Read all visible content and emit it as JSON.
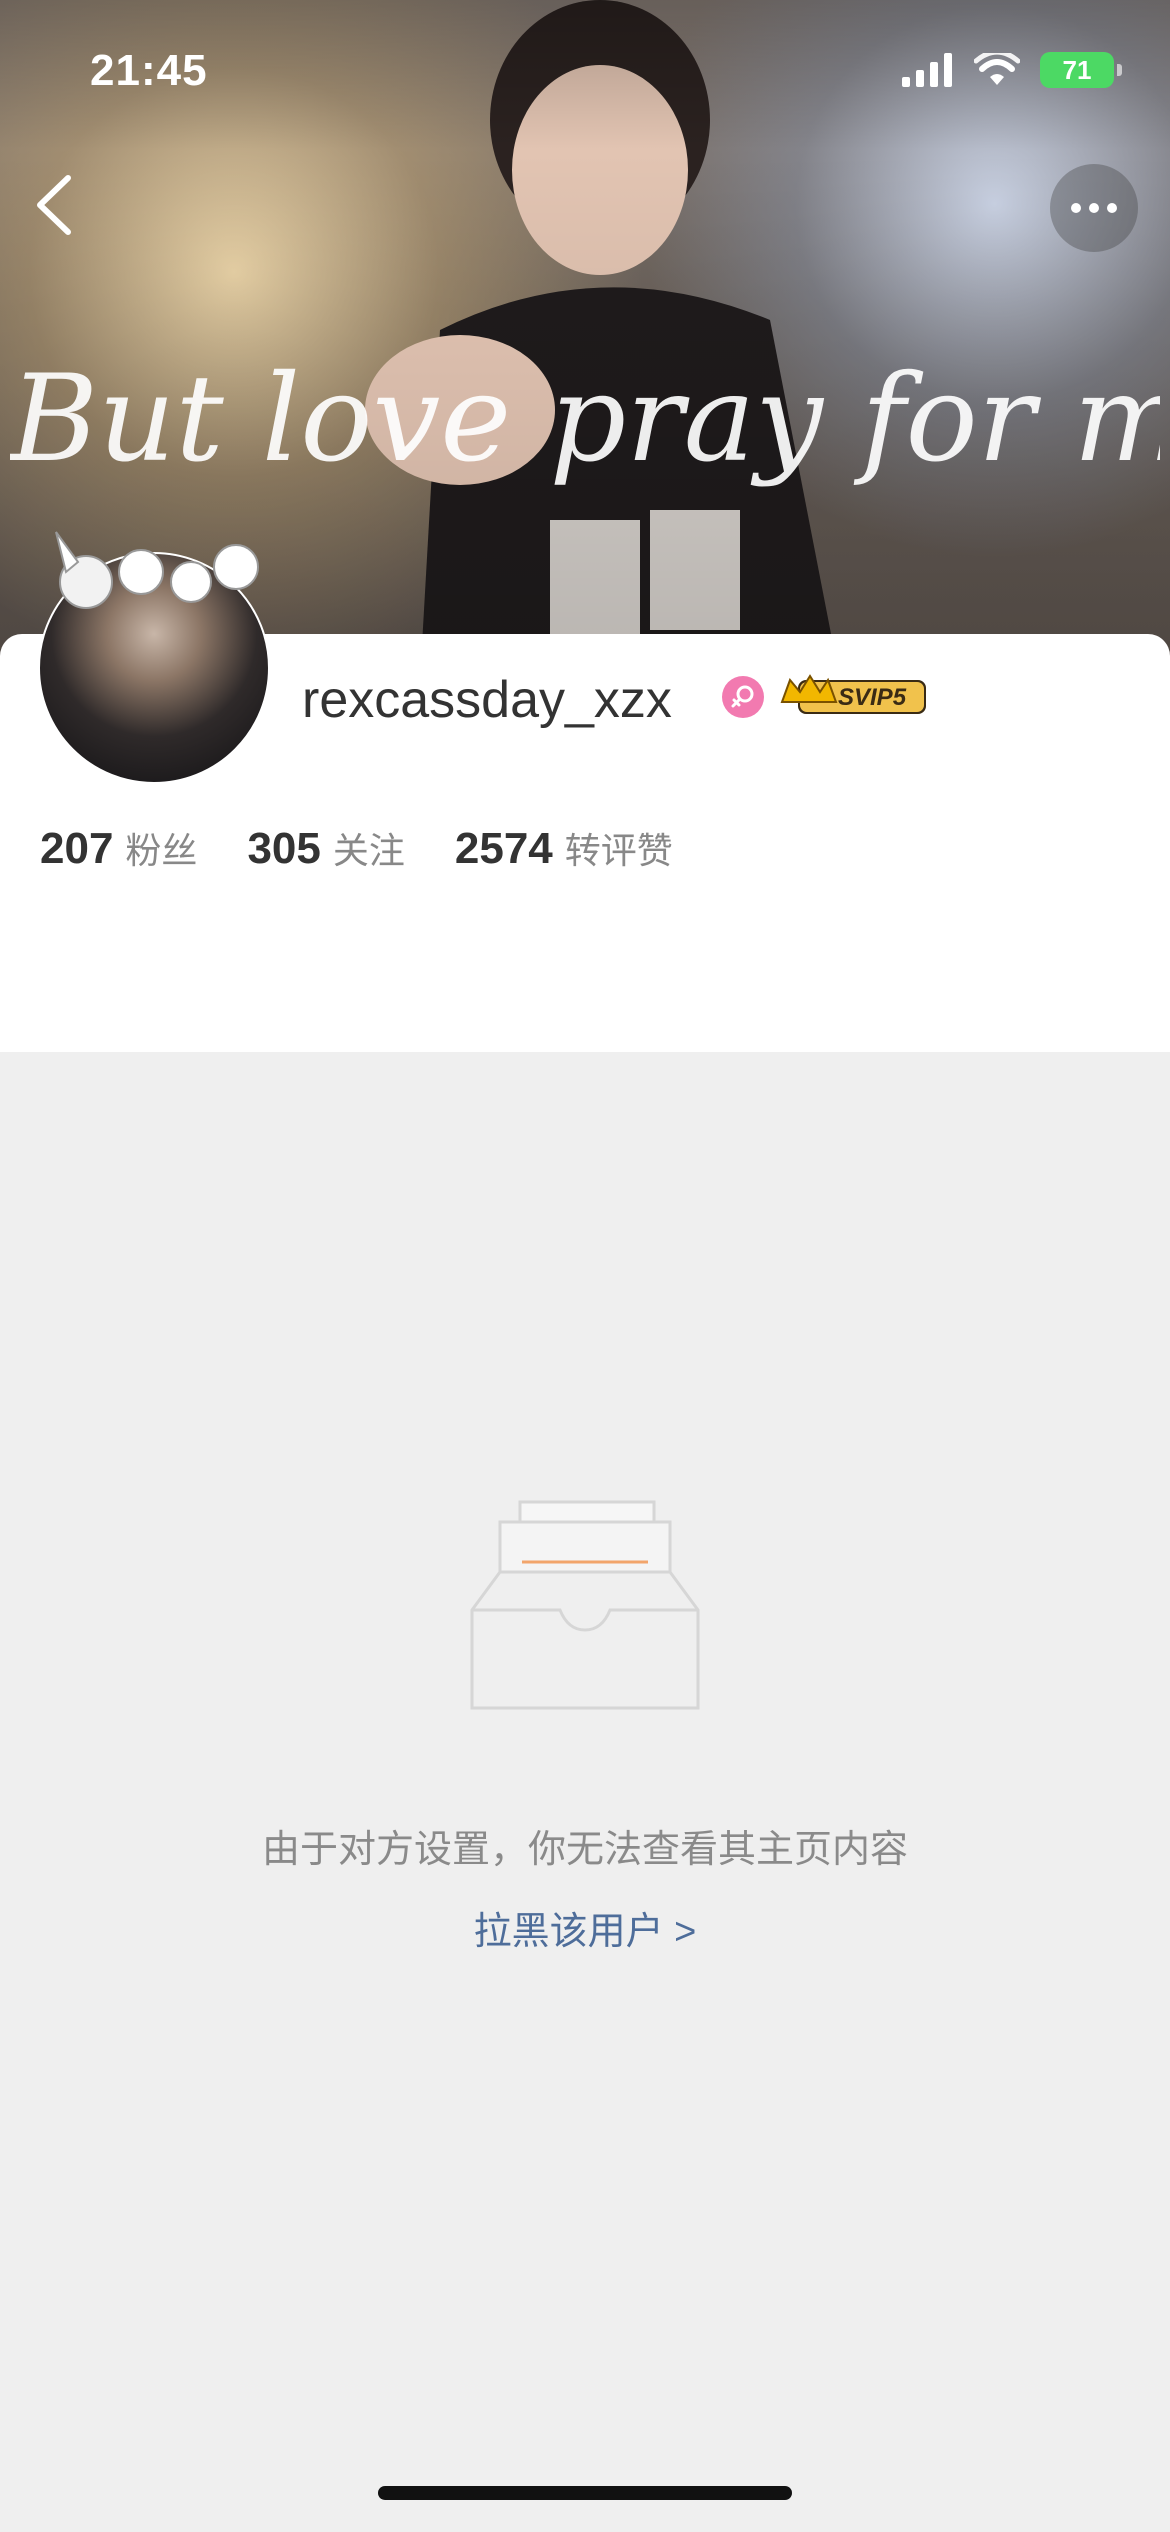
{
  "status_bar": {
    "time": "21:45",
    "battery": "71"
  },
  "header": {
    "back_icon": "chevron-left-icon",
    "more_icon": "ellipsis-icon",
    "cover_text": "But love pray for me"
  },
  "profile": {
    "username": "rexcassday_xzx",
    "gender_icon": "female-icon",
    "gender_color": "#f27ab0",
    "vip_badge": "SVIP5"
  },
  "stats": [
    {
      "value": "207",
      "label": "粉丝"
    },
    {
      "value": "305",
      "label": "关注"
    },
    {
      "value": "2574",
      "label": "转评赞"
    }
  ],
  "empty_state": {
    "icon": "empty-inbox-icon",
    "message": "由于对方设置，你无法查看其主页内容",
    "link": "拉黑该用户 >",
    "link_color": "#4e6d9a"
  }
}
